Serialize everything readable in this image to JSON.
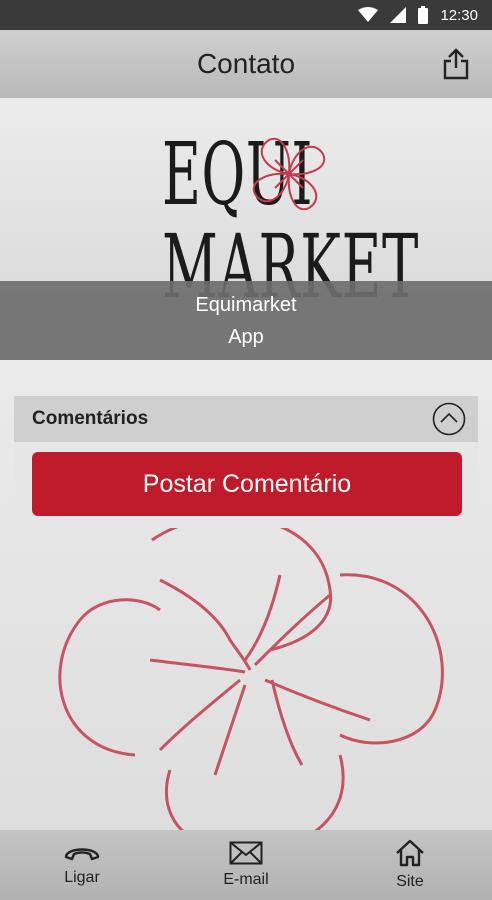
{
  "status_bar": {
    "time": "12:30"
  },
  "app_bar": {
    "title": "Contato",
    "share_icon": "share-icon"
  },
  "hero": {
    "logo_line1": "EQUI",
    "logo_line2": "MARKET",
    "name_line1": "Equimarket",
    "name_line2": "App"
  },
  "comments": {
    "header_label": "Comentários",
    "collapse_icon": "chevron-up-icon",
    "post_button_label": "Postar Comentário"
  },
  "bottom_nav": {
    "items": [
      {
        "label": "Ligar",
        "icon": "phone-icon"
      },
      {
        "label": "E-mail",
        "icon": "mail-icon"
      },
      {
        "label": "Site",
        "icon": "home-icon"
      }
    ]
  },
  "colors": {
    "accent": "#c01b2a",
    "logo_red": "#c43a4a",
    "app_bar": "#c4c4c4",
    "status_bar": "#3a3a3a"
  }
}
